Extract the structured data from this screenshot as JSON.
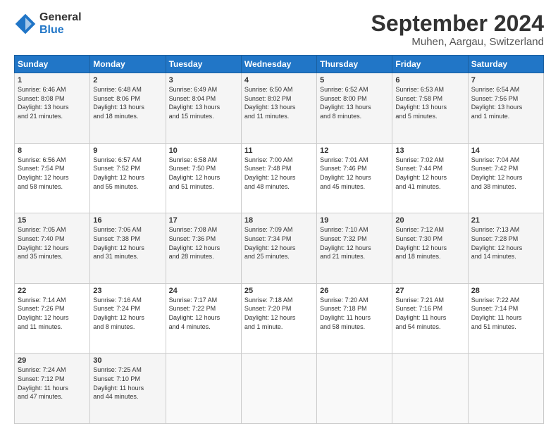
{
  "logo": {
    "general": "General",
    "blue": "Blue"
  },
  "title": "September 2024",
  "location": "Muhen, Aargau, Switzerland",
  "headers": [
    "Sunday",
    "Monday",
    "Tuesday",
    "Wednesday",
    "Thursday",
    "Friday",
    "Saturday"
  ],
  "weeks": [
    [
      {
        "day": "1",
        "sunrise": "6:46 AM",
        "sunset": "8:08 PM",
        "daylight": "13 hours and 21 minutes."
      },
      {
        "day": "2",
        "sunrise": "6:48 AM",
        "sunset": "8:06 PM",
        "daylight": "13 hours and 18 minutes."
      },
      {
        "day": "3",
        "sunrise": "6:49 AM",
        "sunset": "8:04 PM",
        "daylight": "13 hours and 15 minutes."
      },
      {
        "day": "4",
        "sunrise": "6:50 AM",
        "sunset": "8:02 PM",
        "daylight": "13 hours and 11 minutes."
      },
      {
        "day": "5",
        "sunrise": "6:52 AM",
        "sunset": "8:00 PM",
        "daylight": "13 hours and 8 minutes."
      },
      {
        "day": "6",
        "sunrise": "6:53 AM",
        "sunset": "7:58 PM",
        "daylight": "13 hours and 5 minutes."
      },
      {
        "day": "7",
        "sunrise": "6:54 AM",
        "sunset": "7:56 PM",
        "daylight": "13 hours and 1 minute."
      }
    ],
    [
      {
        "day": "8",
        "sunrise": "6:56 AM",
        "sunset": "7:54 PM",
        "daylight": "12 hours and 58 minutes."
      },
      {
        "day": "9",
        "sunrise": "6:57 AM",
        "sunset": "7:52 PM",
        "daylight": "12 hours and 55 minutes."
      },
      {
        "day": "10",
        "sunrise": "6:58 AM",
        "sunset": "7:50 PM",
        "daylight": "12 hours and 51 minutes."
      },
      {
        "day": "11",
        "sunrise": "7:00 AM",
        "sunset": "7:48 PM",
        "daylight": "12 hours and 48 minutes."
      },
      {
        "day": "12",
        "sunrise": "7:01 AM",
        "sunset": "7:46 PM",
        "daylight": "12 hours and 45 minutes."
      },
      {
        "day": "13",
        "sunrise": "7:02 AM",
        "sunset": "7:44 PM",
        "daylight": "12 hours and 41 minutes."
      },
      {
        "day": "14",
        "sunrise": "7:04 AM",
        "sunset": "7:42 PM",
        "daylight": "12 hours and 38 minutes."
      }
    ],
    [
      {
        "day": "15",
        "sunrise": "7:05 AM",
        "sunset": "7:40 PM",
        "daylight": "12 hours and 35 minutes."
      },
      {
        "day": "16",
        "sunrise": "7:06 AM",
        "sunset": "7:38 PM",
        "daylight": "12 hours and 31 minutes."
      },
      {
        "day": "17",
        "sunrise": "7:08 AM",
        "sunset": "7:36 PM",
        "daylight": "12 hours and 28 minutes."
      },
      {
        "day": "18",
        "sunrise": "7:09 AM",
        "sunset": "7:34 PM",
        "daylight": "12 hours and 25 minutes."
      },
      {
        "day": "19",
        "sunrise": "7:10 AM",
        "sunset": "7:32 PM",
        "daylight": "12 hours and 21 minutes."
      },
      {
        "day": "20",
        "sunrise": "7:12 AM",
        "sunset": "7:30 PM",
        "daylight": "12 hours and 18 minutes."
      },
      {
        "day": "21",
        "sunrise": "7:13 AM",
        "sunset": "7:28 PM",
        "daylight": "12 hours and 14 minutes."
      }
    ],
    [
      {
        "day": "22",
        "sunrise": "7:14 AM",
        "sunset": "7:26 PM",
        "daylight": "12 hours and 11 minutes."
      },
      {
        "day": "23",
        "sunrise": "7:16 AM",
        "sunset": "7:24 PM",
        "daylight": "12 hours and 8 minutes."
      },
      {
        "day": "24",
        "sunrise": "7:17 AM",
        "sunset": "7:22 PM",
        "daylight": "12 hours and 4 minutes."
      },
      {
        "day": "25",
        "sunrise": "7:18 AM",
        "sunset": "7:20 PM",
        "daylight": "12 hours and 1 minute."
      },
      {
        "day": "26",
        "sunrise": "7:20 AM",
        "sunset": "7:18 PM",
        "daylight": "11 hours and 58 minutes."
      },
      {
        "day": "27",
        "sunrise": "7:21 AM",
        "sunset": "7:16 PM",
        "daylight": "11 hours and 54 minutes."
      },
      {
        "day": "28",
        "sunrise": "7:22 AM",
        "sunset": "7:14 PM",
        "daylight": "11 hours and 51 minutes."
      }
    ],
    [
      {
        "day": "29",
        "sunrise": "7:24 AM",
        "sunset": "7:12 PM",
        "daylight": "11 hours and 47 minutes."
      },
      {
        "day": "30",
        "sunrise": "7:25 AM",
        "sunset": "7:10 PM",
        "daylight": "11 hours and 44 minutes."
      },
      null,
      null,
      null,
      null,
      null
    ]
  ]
}
